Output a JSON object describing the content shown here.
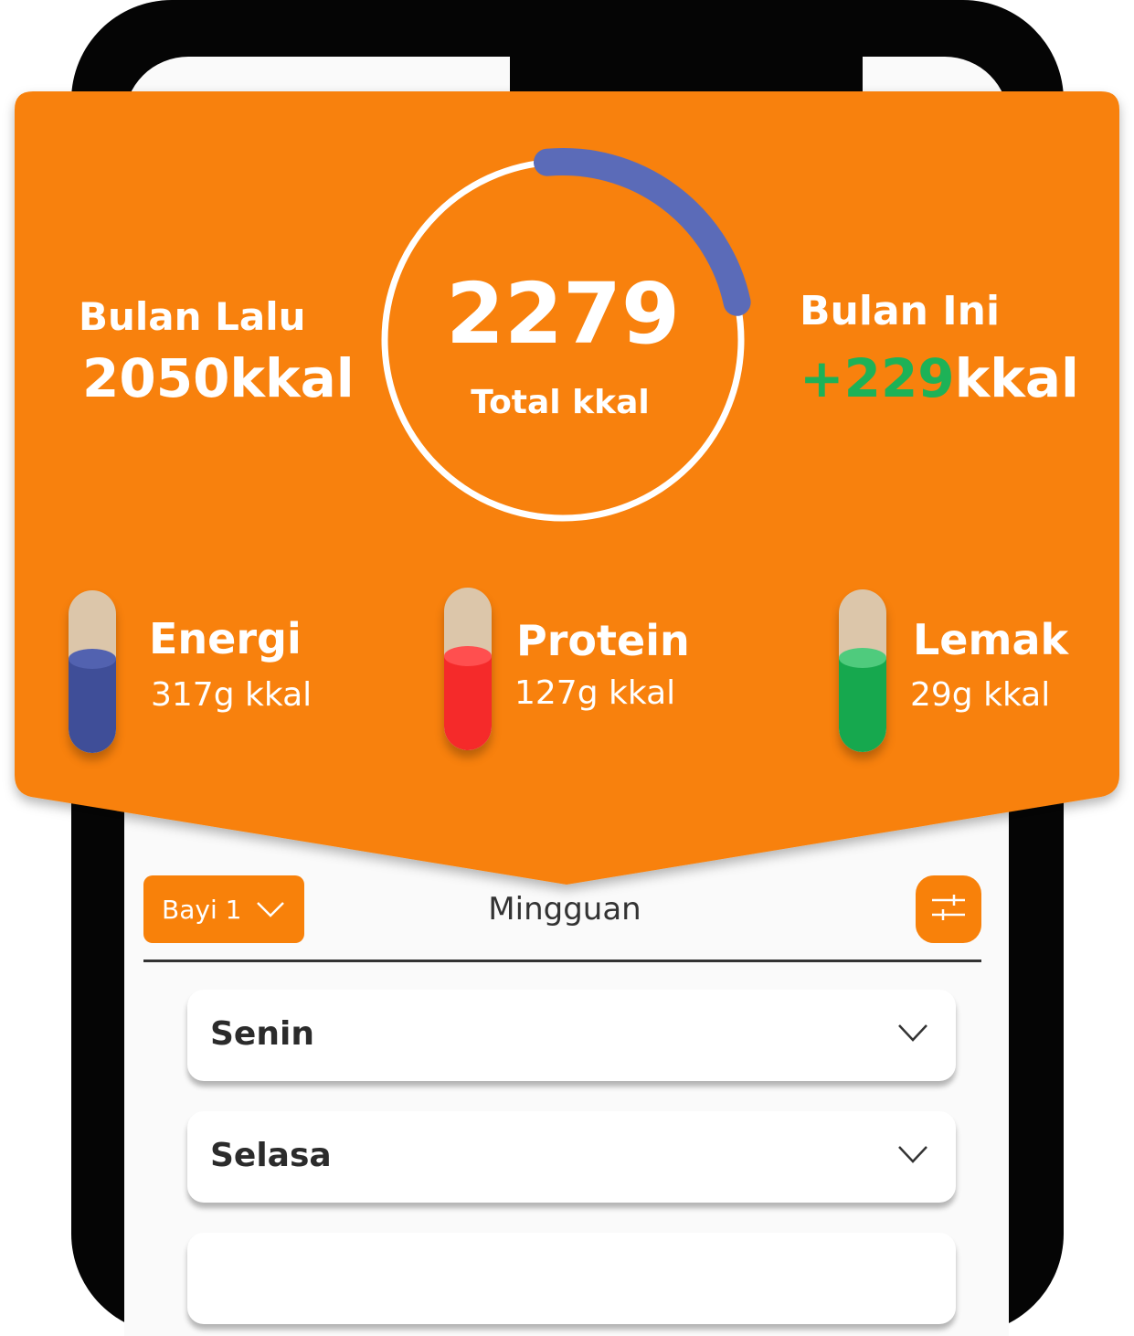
{
  "summary": {
    "previous_month": {
      "label": "Bulan Lalu",
      "value": "2050kkal"
    },
    "current_month": {
      "label": "Bulan Ini",
      "delta": "+229",
      "unit": "kkal"
    },
    "total": {
      "value": "2279",
      "label": "Total kkal",
      "progress_fraction": 0.23
    }
  },
  "nutrients": [
    {
      "name": "Energi",
      "value": "317g kkal",
      "color": "#3f4e98",
      "fill_fraction": 0.58
    },
    {
      "name": "Protein",
      "value": "127g kkal",
      "color": "#f52a2a",
      "fill_fraction": 0.58
    },
    {
      "name": "Lemak",
      "value": "29g kkal",
      "color": "#16a84e",
      "fill_fraction": 0.58
    }
  ],
  "controls": {
    "child_select": "Bayi 1",
    "period": "Mingguan",
    "filter_icon": "sliders-icon"
  },
  "days": [
    "Senin",
    "Selasa"
  ],
  "colors": {
    "accent": "#f8810a",
    "progress_arc": "#5b6bb8",
    "delta_positive": "#1db257"
  }
}
